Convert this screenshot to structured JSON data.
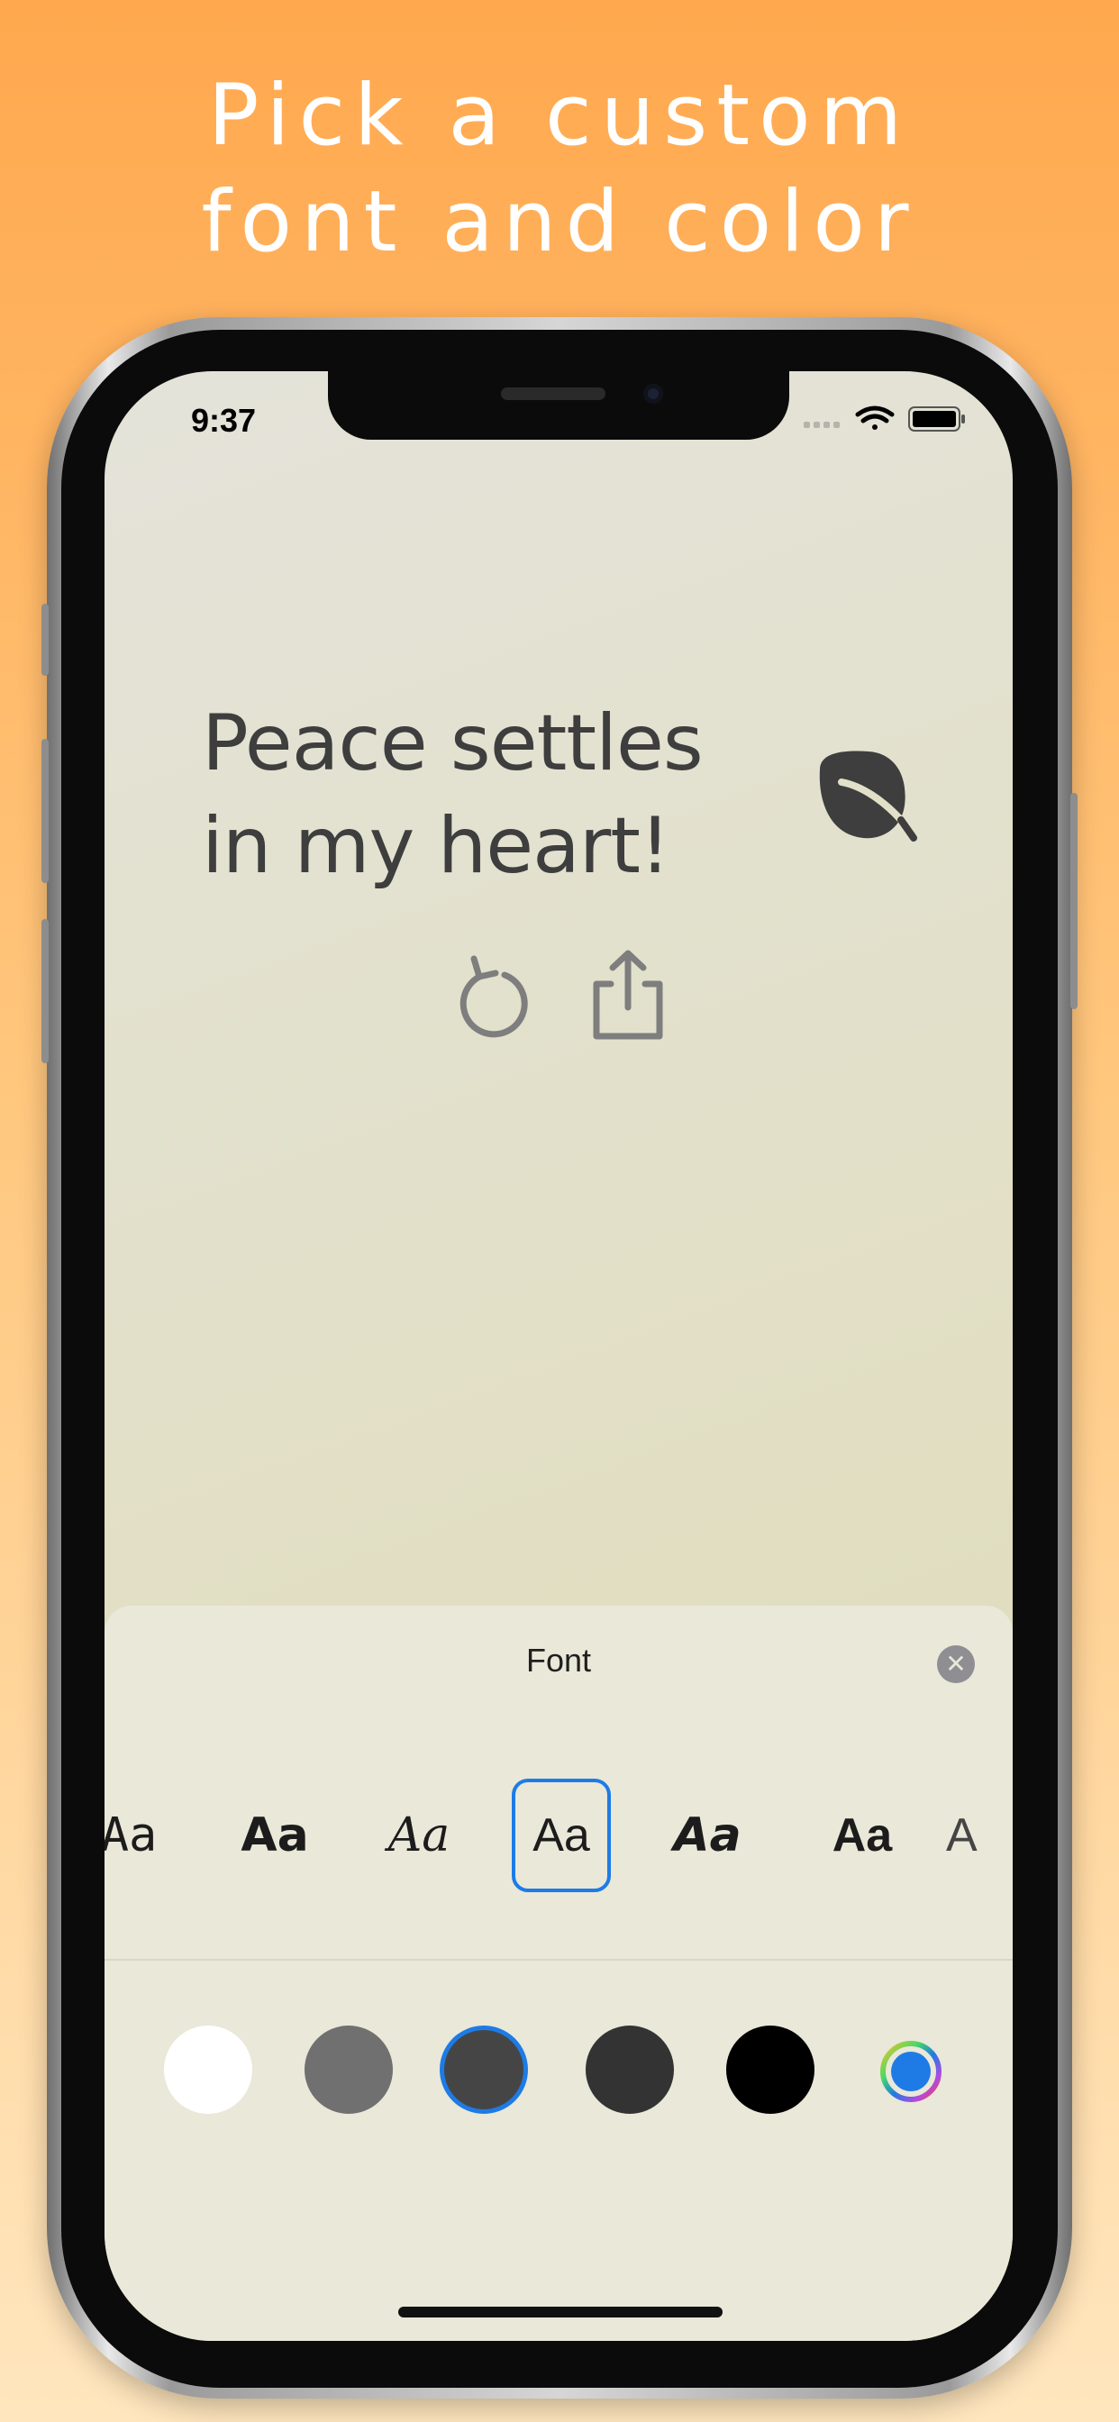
{
  "promo": {
    "line1": "Pick a custom",
    "line2": "font and color"
  },
  "status_bar": {
    "time": "9:37"
  },
  "quote": {
    "text": "Peace settles in my heart!"
  },
  "icons": {
    "leaf": "leaf-icon",
    "refresh": "refresh-icon",
    "share": "share-icon",
    "close": "close-icon",
    "color_wheel": "color-wheel-icon",
    "wifi": "wifi-icon",
    "battery": "battery-icon",
    "signal": "signal-icon"
  },
  "font_sheet": {
    "title": "Font",
    "close_glyph": "✕",
    "options": [
      {
        "label": "Aa",
        "selected": false
      },
      {
        "label": "Aa",
        "selected": false
      },
      {
        "label": "Aa",
        "selected": false
      },
      {
        "label": "Aa",
        "selected": true
      },
      {
        "label": "Aa",
        "selected": false
      },
      {
        "label": "Aa",
        "selected": false
      },
      {
        "label": "A",
        "selected": false
      }
    ],
    "colors": [
      {
        "hex": "#FFFFFF",
        "selected": false
      },
      {
        "hex": "#707070",
        "selected": false
      },
      {
        "hex": "#454545",
        "selected": true
      },
      {
        "hex": "#333333",
        "selected": false
      },
      {
        "hex": "#000000",
        "selected": false
      }
    ]
  },
  "accent_color": "#1E7BE6"
}
